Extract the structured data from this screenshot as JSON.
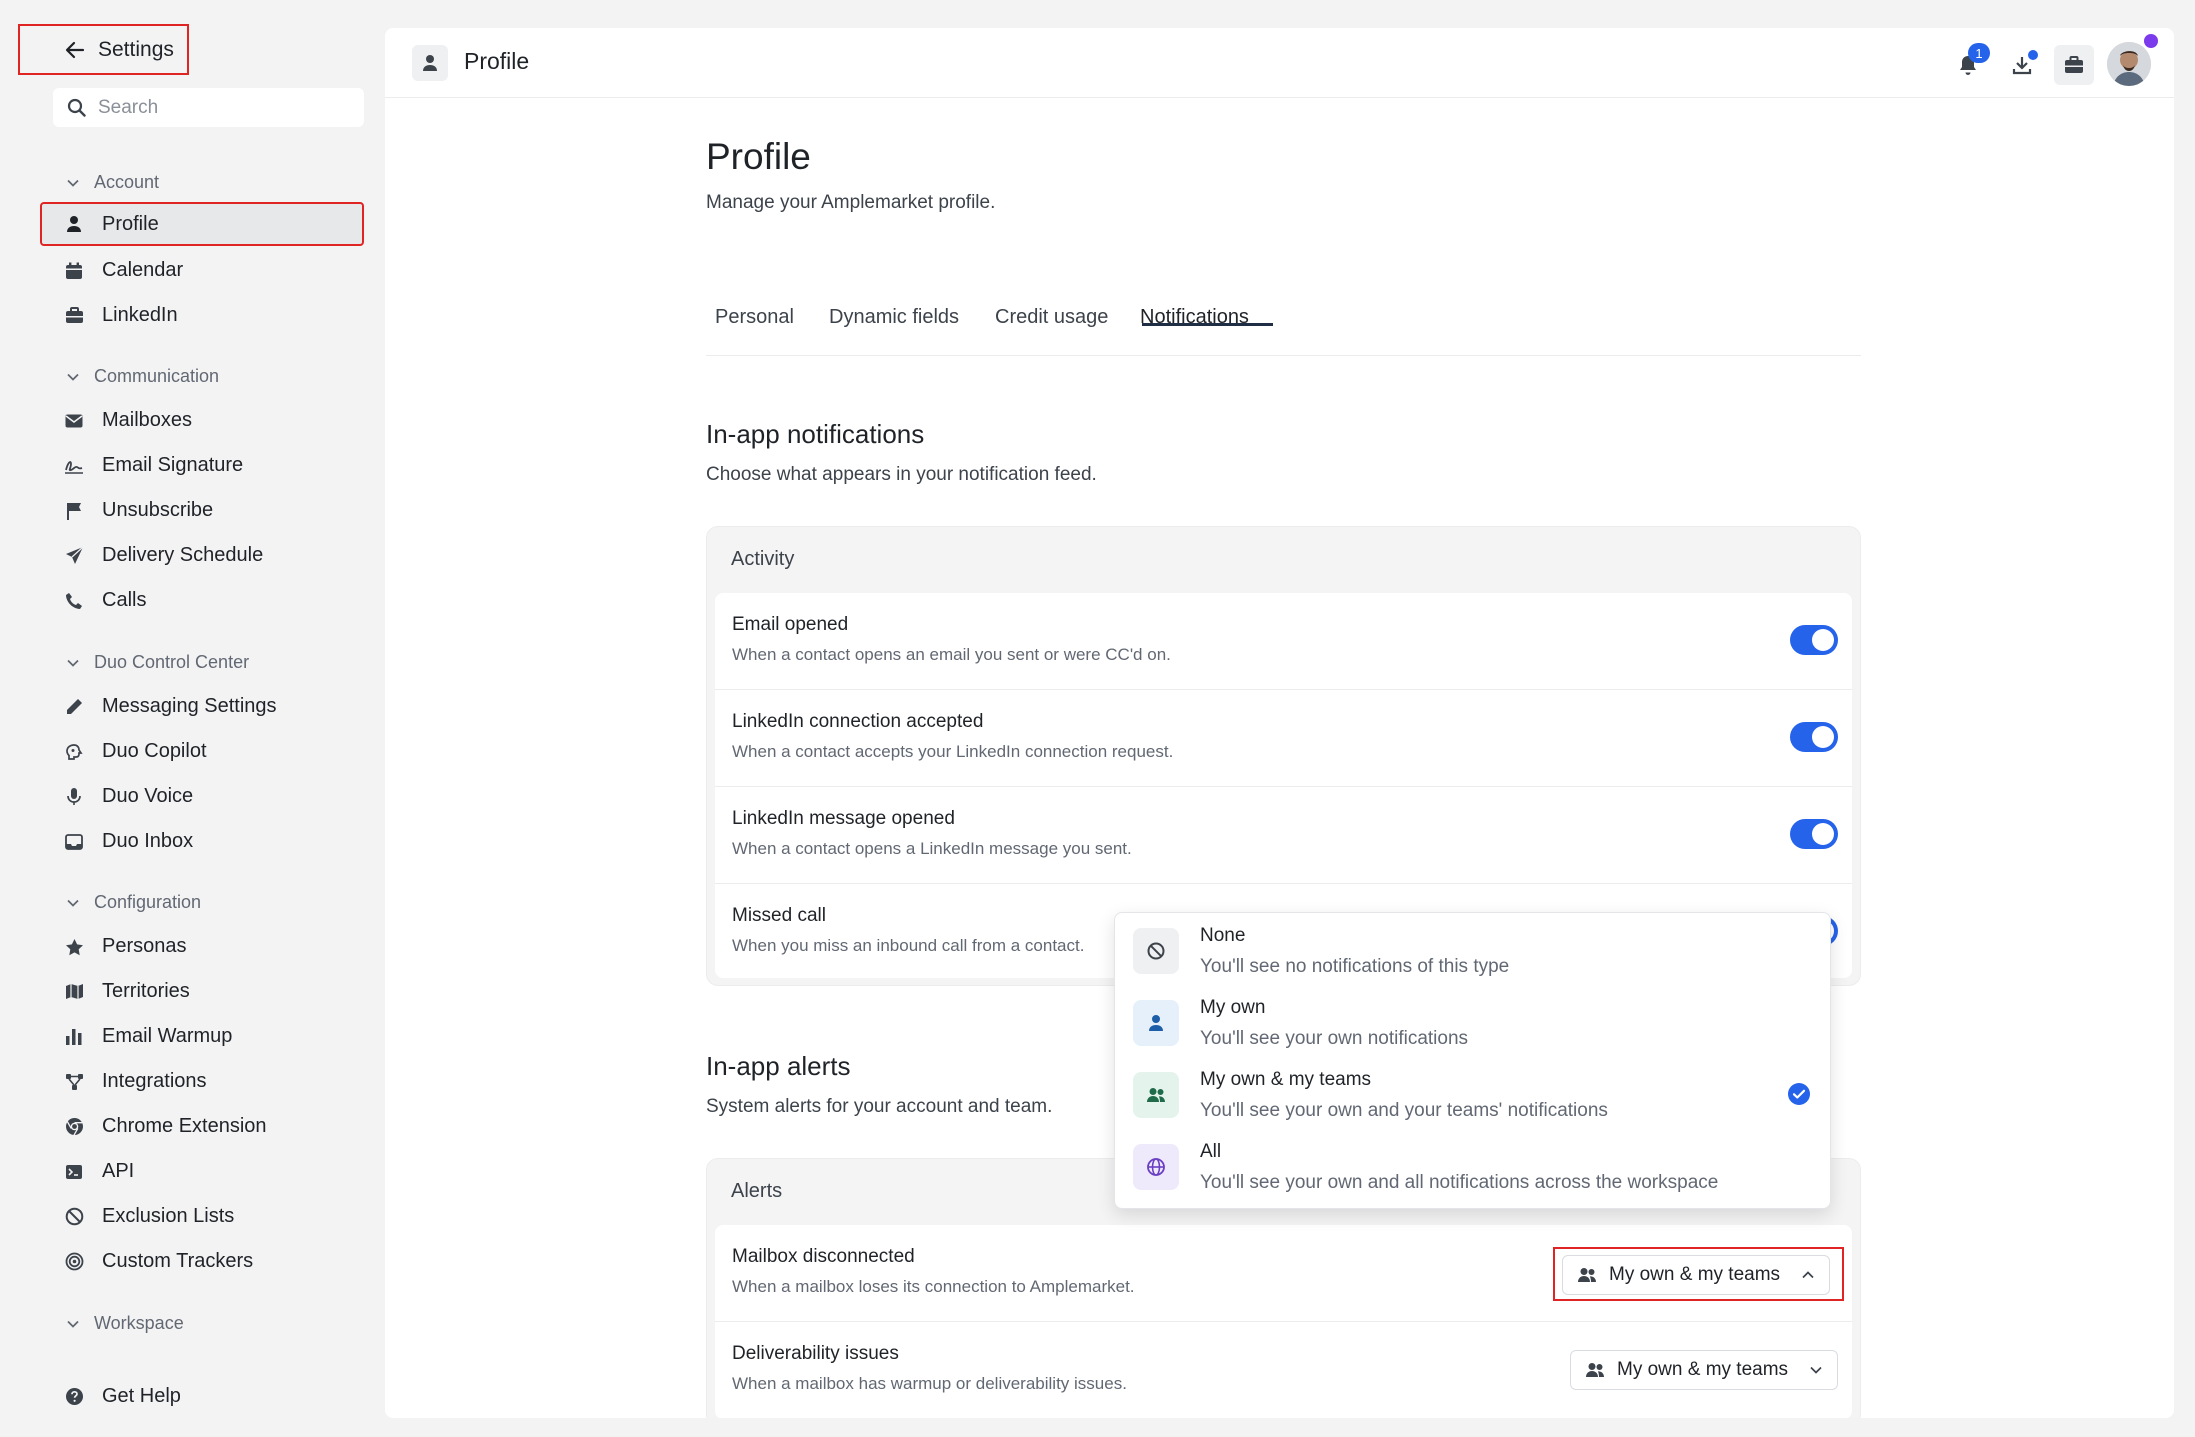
{
  "sidebar": {
    "back_label": "Settings",
    "search_placeholder": "Search",
    "groups": [
      {
        "label": "Account",
        "items": [
          {
            "label": "Profile",
            "icon": "user-icon",
            "active": true
          },
          {
            "label": "Calendar",
            "icon": "calendar-icon"
          },
          {
            "label": "LinkedIn",
            "icon": "briefcase-icon"
          }
        ]
      },
      {
        "label": "Communication",
        "items": [
          {
            "label": "Mailboxes",
            "icon": "envelope-icon"
          },
          {
            "label": "Email Signature",
            "icon": "signature-icon"
          },
          {
            "label": "Unsubscribe",
            "icon": "flag-icon"
          },
          {
            "label": "Delivery Schedule",
            "icon": "paper-plane-icon"
          },
          {
            "label": "Calls",
            "icon": "phone-icon"
          }
        ]
      },
      {
        "label": "Duo Control Center",
        "items": [
          {
            "label": "Messaging Settings",
            "icon": "pen-icon"
          },
          {
            "label": "Duo Copilot",
            "icon": "brain-icon"
          },
          {
            "label": "Duo Voice",
            "icon": "microphone-icon"
          },
          {
            "label": "Duo Inbox",
            "icon": "inbox-icon"
          }
        ]
      },
      {
        "label": "Configuration",
        "items": [
          {
            "label": "Personas",
            "icon": "star-icon"
          },
          {
            "label": "Territories",
            "icon": "map-icon"
          },
          {
            "label": "Email Warmup",
            "icon": "bar-chart-icon"
          },
          {
            "label": "Integrations",
            "icon": "nodes-icon"
          },
          {
            "label": "Chrome Extension",
            "icon": "chrome-icon"
          },
          {
            "label": "API",
            "icon": "terminal-icon"
          },
          {
            "label": "Exclusion Lists",
            "icon": "ban-icon"
          },
          {
            "label": "Custom Trackers",
            "icon": "target-icon"
          }
        ]
      },
      {
        "label": "Workspace",
        "items": []
      }
    ],
    "help_label": "Get Help"
  },
  "topbar": {
    "title": "Profile",
    "notification_count": "1"
  },
  "page": {
    "title": "Profile",
    "subtitle": "Manage your Amplemarket profile.",
    "tabs": [
      "Personal",
      "Dynamic fields",
      "Credit usage",
      "Notifications"
    ],
    "active_tab": "Notifications"
  },
  "inapp_notifications": {
    "title": "In-app notifications",
    "subtitle": "Choose what appears in your notification feed.",
    "card_header": "Activity",
    "rows": [
      {
        "title": "Email opened",
        "desc": "When a contact opens an email you sent or were CC'd on.",
        "enabled": true
      },
      {
        "title": "LinkedIn connection accepted",
        "desc": "When a contact accepts your LinkedIn connection request.",
        "enabled": true
      },
      {
        "title": "LinkedIn message opened",
        "desc": "When a contact opens a LinkedIn message you sent.",
        "enabled": true
      },
      {
        "title": "Missed call",
        "desc": "When you miss an inbound call from a contact.",
        "enabled": true
      }
    ]
  },
  "inapp_alerts": {
    "title": "In-app alerts",
    "subtitle": "System alerts for your account and team.",
    "card_header": "Alerts",
    "rows": [
      {
        "title": "Mailbox disconnected",
        "desc": "When a mailbox loses its connection to Amplemarket.",
        "value": "My own & my teams"
      },
      {
        "title": "Deliverability issues",
        "desc": "When a mailbox has warmup or deliverability issues.",
        "value": "My own & my teams"
      }
    ]
  },
  "dropdown": {
    "selected": "My own & my teams",
    "options": [
      {
        "title": "None",
        "desc": "You'll see no notifications of this type",
        "icon": "ban-icon"
      },
      {
        "title": "My own",
        "desc": "You'll see your own notifications",
        "icon": "user-icon"
      },
      {
        "title": "My own & my teams",
        "desc": "You'll see your own and your teams' notifications",
        "icon": "users-icon"
      },
      {
        "title": "All",
        "desc": "You'll see your own and all notifications across the workspace",
        "icon": "globe-icon"
      }
    ]
  },
  "colors": {
    "accent": "#2563eb",
    "highlight": "#e02424",
    "sidebar_bg": "#f3f3f4"
  }
}
